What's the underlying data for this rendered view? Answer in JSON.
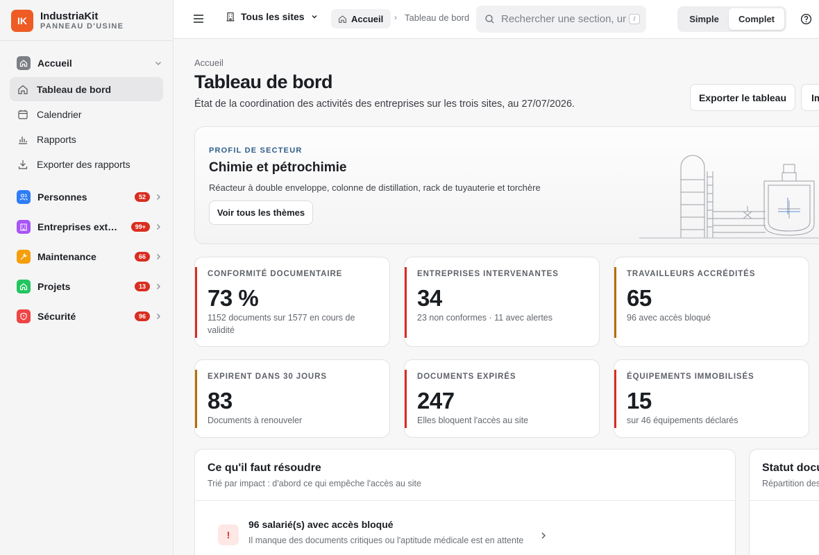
{
  "brand": {
    "logo": "IK",
    "name": "IndustriaKit",
    "subtitle": "PANNEAU D'USINE"
  },
  "sidebar": {
    "home_group": {
      "label": "Accueil",
      "icon": "home-icon"
    },
    "home_items": [
      {
        "label": "Tableau de bord",
        "icon": "home-outline-icon",
        "active": true
      },
      {
        "label": "Calendrier",
        "icon": "calendar-icon"
      },
      {
        "label": "Rapports",
        "icon": "bar-chart-icon"
      },
      {
        "label": "Exporter des rapports",
        "icon": "download-icon"
      }
    ],
    "groups": [
      {
        "label": "Personnes",
        "badge": "52",
        "color": "#2f7df6",
        "icon": "users-icon"
      },
      {
        "label": "Entreprises extérieures",
        "badge": "99+",
        "color": "#a855f7",
        "icon": "building-icon"
      },
      {
        "label": "Maintenance",
        "badge": "66",
        "color": "#f59e0b",
        "icon": "wrench-icon"
      },
      {
        "label": "Projets",
        "badge": "13",
        "color": "#22c55e",
        "icon": "home-icon"
      },
      {
        "label": "Sécurité",
        "badge": "96",
        "color": "#ef4444",
        "icon": "shield-icon"
      }
    ]
  },
  "header": {
    "site_selector": "Tous les sites",
    "breadcrumb_home": "Accueil",
    "breadcrumb_current": "Tableau de bord",
    "search_placeholder": "Rechercher une section, un",
    "search_shortcut": "/",
    "mode_simple": "Simple",
    "mode_complet": "Complet"
  },
  "page": {
    "breadcrumb": "Accueil",
    "title": "Tableau de bord",
    "subtitle": "État de la coordination des activités des entreprises sur les trois sites, au 27/07/2026.",
    "export_button": "Exporter le tableau",
    "more_button": "Im"
  },
  "profile": {
    "kicker": "PROFIL DE SECTEUR",
    "title": "Chimie et pétrochimie",
    "description": "Réacteur à double enveloppe, colonne de distillation, rack de tuyauterie et torchère",
    "button": "Voir tous les thèmes"
  },
  "kpis": [
    {
      "label": "CONFORMITÉ DOCUMENTAIRE",
      "value": "73 %",
      "desc": "1152 documents sur 1577 en cours de validité",
      "color": "#d92d20"
    },
    {
      "label": "ENTREPRISES INTERVENANTES",
      "value": "34",
      "desc": "23 non conformes · 11 avec alertes",
      "color": "#d92d20"
    },
    {
      "label": "TRAVAILLEURS ACCRÉDITÉS",
      "value": "65",
      "desc": "96 avec accès bloqué",
      "color": "#b76e00"
    },
    {
      "label": "EXPIRENT DANS 30 JOURS",
      "value": "83",
      "desc": "Documents à renouveler",
      "color": "#b76e00"
    },
    {
      "label": "DOCUMENTS EXPIRÉS",
      "value": "247",
      "desc": "Elles bloquent l'accès au site",
      "color": "#d92d20"
    },
    {
      "label": "ÉQUIPEMENTS IMMOBILISÉS",
      "value": "15",
      "desc": "sur 46 équipements déclarés",
      "color": "#d92d20"
    }
  ],
  "resolve": {
    "title": "Ce qu'il faut résoudre",
    "subtitle": "Trié par impact : d'abord ce qui empêche l'accès au site",
    "issue_icon": "!",
    "issue_title": "96 salarié(s) avec accès bloqué",
    "issue_desc": "Il manque des documents critiques ou l'aptitude médicale est en attente"
  },
  "status_panel": {
    "title": "Statut documentaire",
    "subtitle": "Répartition des documents"
  }
}
